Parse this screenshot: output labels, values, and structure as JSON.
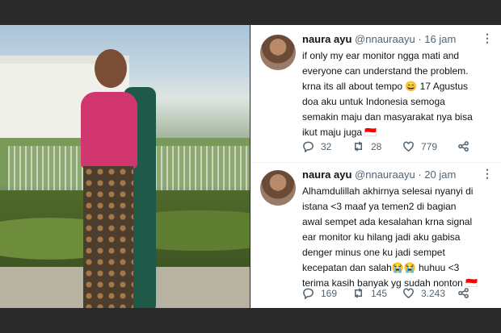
{
  "tweets": [
    {
      "name": "naura ayu",
      "handle": "@nnauraayu",
      "sep": "·",
      "time": "16 jam",
      "menu": "⋮",
      "text": "if only my ear monitor ngga mati and\neveryone can understand the problem.\nkrna its all about tempo 😄 17 Agustus\ndoa aku untuk Indonesia semoga\nsemakin maju dan masyarakat nya bisa\nikut maju juga 🇮🇩",
      "replies": "32",
      "retweets": "28",
      "likes": "779"
    },
    {
      "name": "naura ayu",
      "handle": "@nnauraayu",
      "sep": "·",
      "time": "20 jam",
      "menu": "⋮",
      "text": "Alhamdulillah akhirnya selesai nyanyi di\nistana <3 maaf ya temen2 di bagian\nawal sempet ada kesalahan krna signal\near monitor ku hilang jadi aku gabisa\ndenger minus one ku jadi sempet\nkecepatan dan salah😭😭 huhuu <3\nterima kasih banyak yg sudah nonton 🇮🇩",
      "replies": "169",
      "retweets": "145",
      "likes": "3.243"
    }
  ],
  "icons": [
    "reply-icon",
    "retweet-icon",
    "like-icon",
    "share-icon",
    "more-icon"
  ]
}
